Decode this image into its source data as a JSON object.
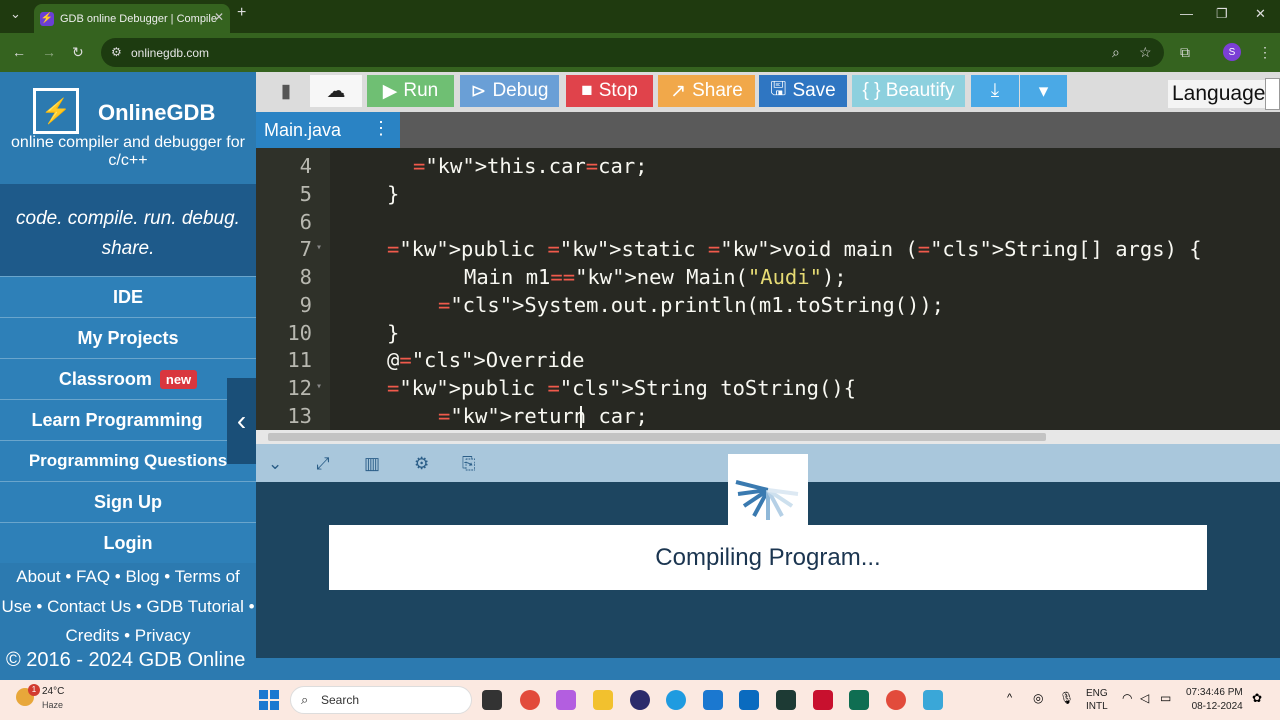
{
  "browser": {
    "tab_title": "GDB online Debugger | Compile",
    "url": "onlinegdb.com",
    "profile_initial": "S"
  },
  "sidebar": {
    "brand": "OnlineGDB",
    "tagline": "online compiler and debugger for c/c++",
    "slogan": "code. compile. run. debug. share.",
    "items": [
      {
        "label": "IDE"
      },
      {
        "label": "My Projects"
      },
      {
        "label": "Classroom",
        "badge": "new"
      },
      {
        "label": "Learn Programming"
      },
      {
        "label": "Programming Questions"
      },
      {
        "label": "Sign Up"
      },
      {
        "label": "Login"
      }
    ],
    "footer": "About • FAQ • Blog • Terms of Use • Contact Us • GDB Tutorial • Credits • Privacy",
    "copyright": "© 2016 - 2024 GDB Online"
  },
  "toolbar": {
    "run": "Run",
    "debug": "Debug",
    "stop": "Stop",
    "share": "Share",
    "save": "Save",
    "beautify": "{ } Beautify",
    "language_label": "Language"
  },
  "file_tab": "Main.java",
  "editor": {
    "lines": [
      {
        "n": "4",
        "code": "this.car=car;"
      },
      {
        "n": "5",
        "code": "}"
      },
      {
        "n": "6",
        "code": ""
      },
      {
        "n": "7",
        "code": "public static void main (String[] args) {"
      },
      {
        "n": "8",
        "code": "Main m1=new Main(\"Audi\");"
      },
      {
        "n": "9",
        "code": "System.out.println(m1.toString());"
      },
      {
        "n": "10",
        "code": "}"
      },
      {
        "n": "11",
        "code": "@Override"
      },
      {
        "n": "12",
        "code": "public String toString(){"
      },
      {
        "n": "13",
        "code": "return car;"
      }
    ]
  },
  "console": {
    "message": "Compiling Program..."
  },
  "taskbar": {
    "temperature": "24°C",
    "weather": "Haze",
    "search_placeholder": "Search",
    "lang1": "ENG",
    "lang2": "INTL",
    "time": "07:34:46 PM",
    "date": "08-12-2024",
    "notification_count": "1"
  }
}
